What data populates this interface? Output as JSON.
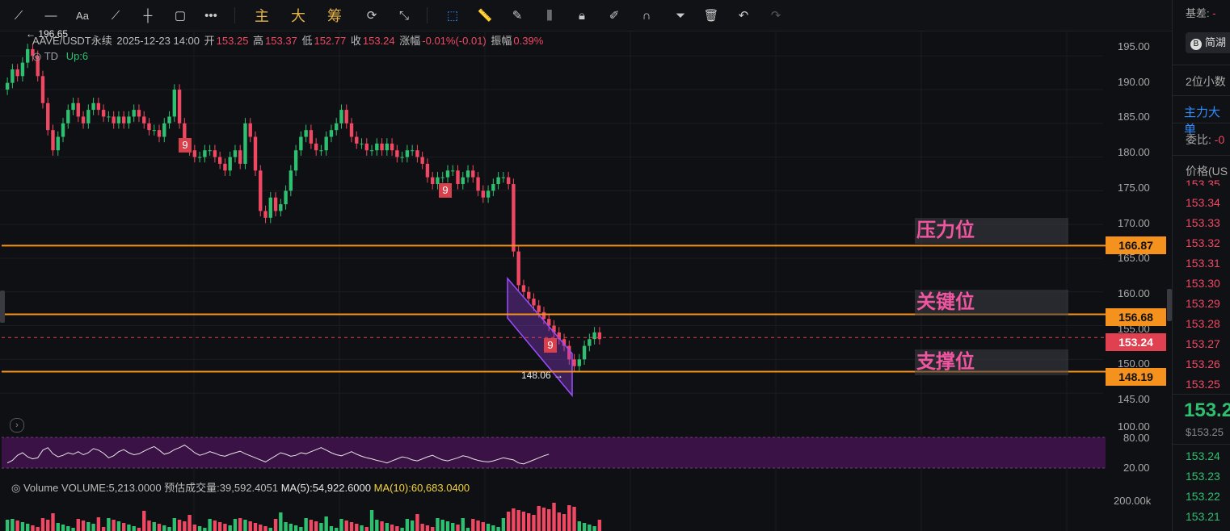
{
  "toolbar": {
    "items": [
      "主",
      "大",
      "筹"
    ]
  },
  "header": {
    "symbol": "AAVE/USDT永续",
    "datetime": "2025-12-23 14:00",
    "open_label": "开",
    "open": "153.25",
    "high_label": "高",
    "high": "153.37",
    "low_label": "低",
    "low": "152.77",
    "close_label": "收",
    "close": "153.24",
    "change_label": "涨幅",
    "change": "-0.01%(-0.01)",
    "amp_label": "振幅",
    "amp": "0.39%"
  },
  "indicator": {
    "name": "TD",
    "up": "Up:6"
  },
  "annotations": {
    "peak": "← 196.65",
    "low": "148.06 →",
    "pressure": "压力位",
    "key": "关键位",
    "support": "支撑位",
    "nine": "9"
  },
  "price_axis": [
    "195.00",
    "190.00",
    "185.00",
    "180.00",
    "175.00",
    "170.00",
    "165.00",
    "160.00",
    "155.00",
    "150.00",
    "145.00"
  ],
  "price_boxes": {
    "pressure": "166.87",
    "key": "156.68",
    "current": "153.24",
    "support": "148.19"
  },
  "rsi_axis": [
    "100.00",
    "80.00",
    "20.00"
  ],
  "volume": {
    "label": "Volume",
    "volume": "VOLUME:5,213.0000",
    "estimate": "预估成交量:39,592.4051",
    "ma5": "MA(5):54,922.6000",
    "ma10": "MA(10):60,683.0400",
    "axis": "200.00k"
  },
  "right_panel": {
    "diff_label": "基差:",
    "diff_value": "-",
    "button": "简湖",
    "decimals": "2位小数",
    "main_force": "主力大单",
    "ratio_label": "委比:",
    "ratio_value": "-0",
    "price_header": "价格(US",
    "asks": [
      "153.35",
      "153.34",
      "153.33",
      "153.32",
      "153.31",
      "153.30",
      "153.29",
      "153.28",
      "153.27",
      "153.26",
      "153.25"
    ],
    "last": "153.2",
    "last_usd": "$153.25",
    "bids": [
      "153.24",
      "153.23",
      "153.22",
      "153.21"
    ]
  },
  "colors": {
    "up": "#2fbf71",
    "down": "#f04863",
    "level": "#f5921e",
    "rsi_bg": "#3a1245",
    "tag": "#f0559f"
  },
  "chart_data": {
    "type": "candlestick",
    "ylim": [
      142.5,
      198.5
    ],
    "levels": {
      "pressure": 166.87,
      "key": 156.68,
      "current": 153.24,
      "support": 148.19
    },
    "close_series": [
      191,
      193,
      192,
      194,
      196,
      195,
      192,
      188,
      184,
      181,
      183,
      185,
      187,
      188,
      186,
      185,
      187,
      188,
      187,
      186,
      186,
      185,
      186,
      185,
      186,
      187,
      186,
      185,
      184,
      184,
      183,
      185,
      186,
      190,
      185,
      182,
      181,
      180,
      180,
      181,
      181,
      180,
      179,
      178,
      180,
      181,
      179,
      185,
      183,
      178,
      172,
      171,
      174,
      172,
      173,
      175,
      178,
      181,
      183,
      184,
      182,
      181,
      181,
      183,
      184,
      185,
      187,
      185,
      183,
      182,
      182,
      181,
      181,
      182,
      181,
      182,
      181,
      180,
      180,
      181,
      181,
      180,
      179,
      177,
      176,
      177,
      177,
      178,
      178,
      176,
      177,
      178,
      177,
      175,
      174,
      175,
      176,
      177,
      177,
      176,
      166,
      161,
      160,
      159,
      158,
      157,
      156,
      155,
      154,
      153,
      152,
      150,
      149,
      150,
      152,
      153,
      154,
      153
    ],
    "rsi_series": [
      30,
      35,
      45,
      50,
      42,
      38,
      40,
      55,
      60,
      48,
      42,
      45,
      50,
      47,
      52,
      46,
      50,
      58,
      55,
      49,
      40,
      44,
      52,
      56,
      50,
      46,
      48,
      53,
      58,
      62,
      55,
      47,
      50,
      56,
      60,
      65,
      58,
      50,
      45,
      48,
      52,
      49,
      45,
      43,
      47,
      50,
      53,
      48,
      44,
      40,
      36,
      32,
      38,
      44,
      50,
      47,
      43,
      45,
      50,
      48,
      52,
      56,
      60,
      55,
      50,
      46,
      44,
      48,
      52,
      47,
      43,
      40,
      38,
      35,
      33,
      30,
      34,
      38,
      42,
      40,
      36,
      34,
      38,
      42,
      45,
      40,
      36,
      34,
      37,
      40,
      44,
      42,
      38,
      35,
      33,
      32,
      34,
      37,
      40,
      38,
      36,
      30,
      28,
      32,
      36,
      40,
      44,
      47
    ]
  }
}
